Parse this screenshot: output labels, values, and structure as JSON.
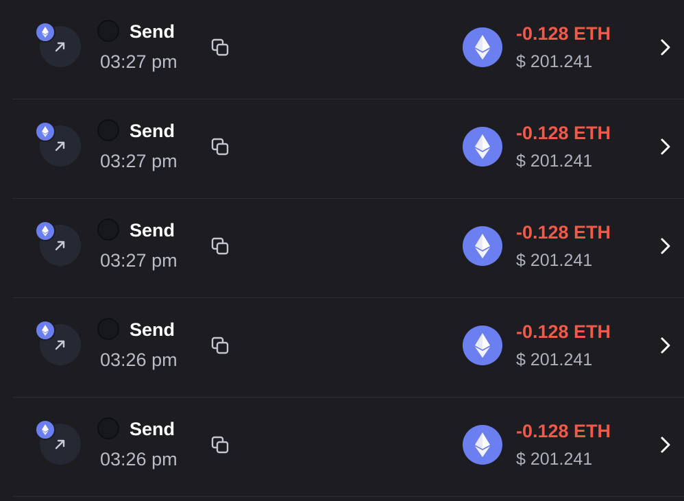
{
  "transactions": [
    {
      "type": "Send",
      "time": "03:27 pm",
      "amount": "-0.128 ETH",
      "fiat": "$ 201.241"
    },
    {
      "type": "Send",
      "time": "03:27 pm",
      "amount": "-0.128 ETH",
      "fiat": "$ 201.241"
    },
    {
      "type": "Send",
      "time": "03:27 pm",
      "amount": "-0.128 ETH",
      "fiat": "$ 201.241"
    },
    {
      "type": "Send",
      "time": "03:26 pm",
      "amount": "-0.128 ETH",
      "fiat": "$ 201.241"
    },
    {
      "type": "Send",
      "time": "03:26 pm",
      "amount": "-0.128 ETH",
      "fiat": "$ 201.241"
    }
  ],
  "icons": {
    "direction": "arrow-up-right-icon",
    "chain": "ethereum-icon",
    "copy": "copy-icon",
    "asset": "ethereum-icon",
    "navigate": "chevron-right-icon"
  },
  "colors": {
    "background": "#1c1c21",
    "eth_accent": "#6c7ff0",
    "negative_amount": "#ef5a4a",
    "secondary_text": "#b9bcc7"
  }
}
